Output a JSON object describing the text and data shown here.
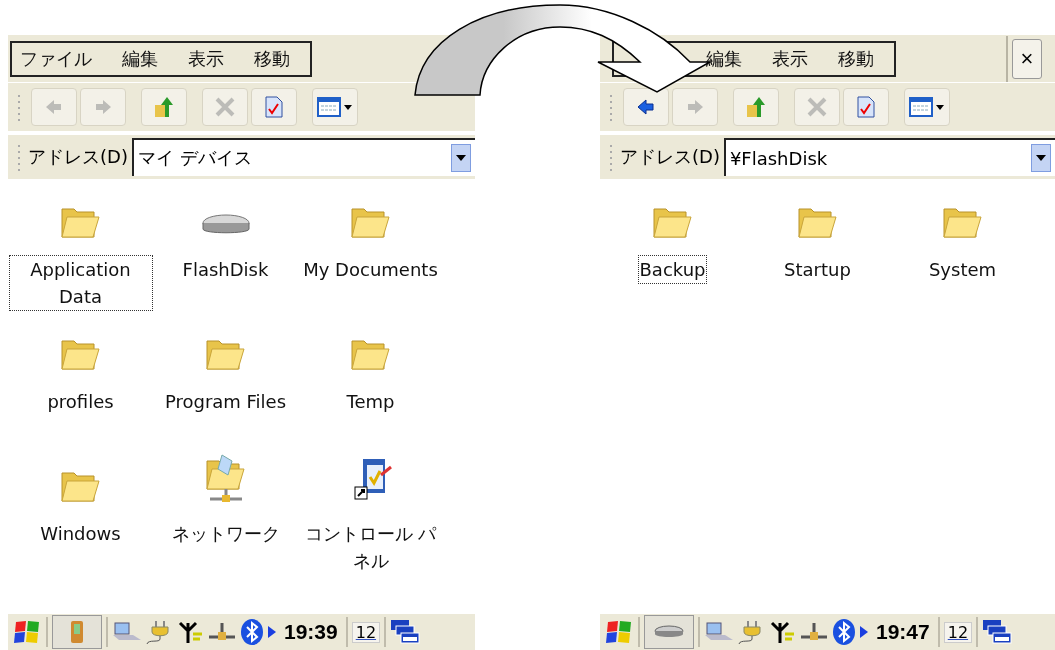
{
  "panels": [
    {
      "menu": [
        "ファイル",
        "編集",
        "表示",
        "移動"
      ],
      "toolbar": [
        {
          "kind": "back",
          "disabled": true
        },
        {
          "kind": "forward",
          "disabled": true
        },
        {
          "kind": "up",
          "disabled": false
        },
        {
          "kind": "delete",
          "disabled": true
        },
        {
          "kind": "properties",
          "disabled": false
        },
        {
          "kind": "views",
          "disabled": false
        }
      ],
      "address": {
        "label": "アドレス(D)",
        "value": "マイ デバイス"
      },
      "items": [
        {
          "kind": "folder",
          "label": "Application Data",
          "selected": true
        },
        {
          "kind": "drive",
          "label": "FlashDisk",
          "selected": false
        },
        {
          "kind": "folder",
          "label": "My Documents",
          "selected": false
        },
        {
          "kind": "folder",
          "label": "profiles",
          "selected": false
        },
        {
          "kind": "folder",
          "label": "Program Files",
          "selected": false
        },
        {
          "kind": "folder",
          "label": "Temp",
          "selected": false
        },
        {
          "kind": "folder",
          "label": "Windows",
          "selected": false
        },
        {
          "kind": "network",
          "label": "ネットワーク",
          "selected": false
        },
        {
          "kind": "control-panel",
          "label": "コントロール パネル",
          "selected": false
        }
      ],
      "taskbar": {
        "app": {
          "kind": "device"
        },
        "time": "19:39",
        "input": "12"
      }
    },
    {
      "menu": [
        "編集",
        "表示",
        "移動"
      ],
      "close": "×",
      "toolbar": [
        {
          "kind": "back",
          "disabled": false
        },
        {
          "kind": "forward",
          "disabled": true
        },
        {
          "kind": "up",
          "disabled": false
        },
        {
          "kind": "delete",
          "disabled": true
        },
        {
          "kind": "properties",
          "disabled": false
        },
        {
          "kind": "views",
          "disabled": false
        }
      ],
      "address": {
        "label": "アドレス(D)",
        "value": "¥FlashDisk"
      },
      "items": [
        {
          "kind": "folder",
          "label": "Backup",
          "selected": true
        },
        {
          "kind": "folder",
          "label": "Startup",
          "selected": false
        },
        {
          "kind": "folder",
          "label": "System",
          "selected": false
        }
      ],
      "taskbar": {
        "app": {
          "kind": "drive"
        },
        "time": "19:47",
        "input": "12"
      }
    }
  ]
}
